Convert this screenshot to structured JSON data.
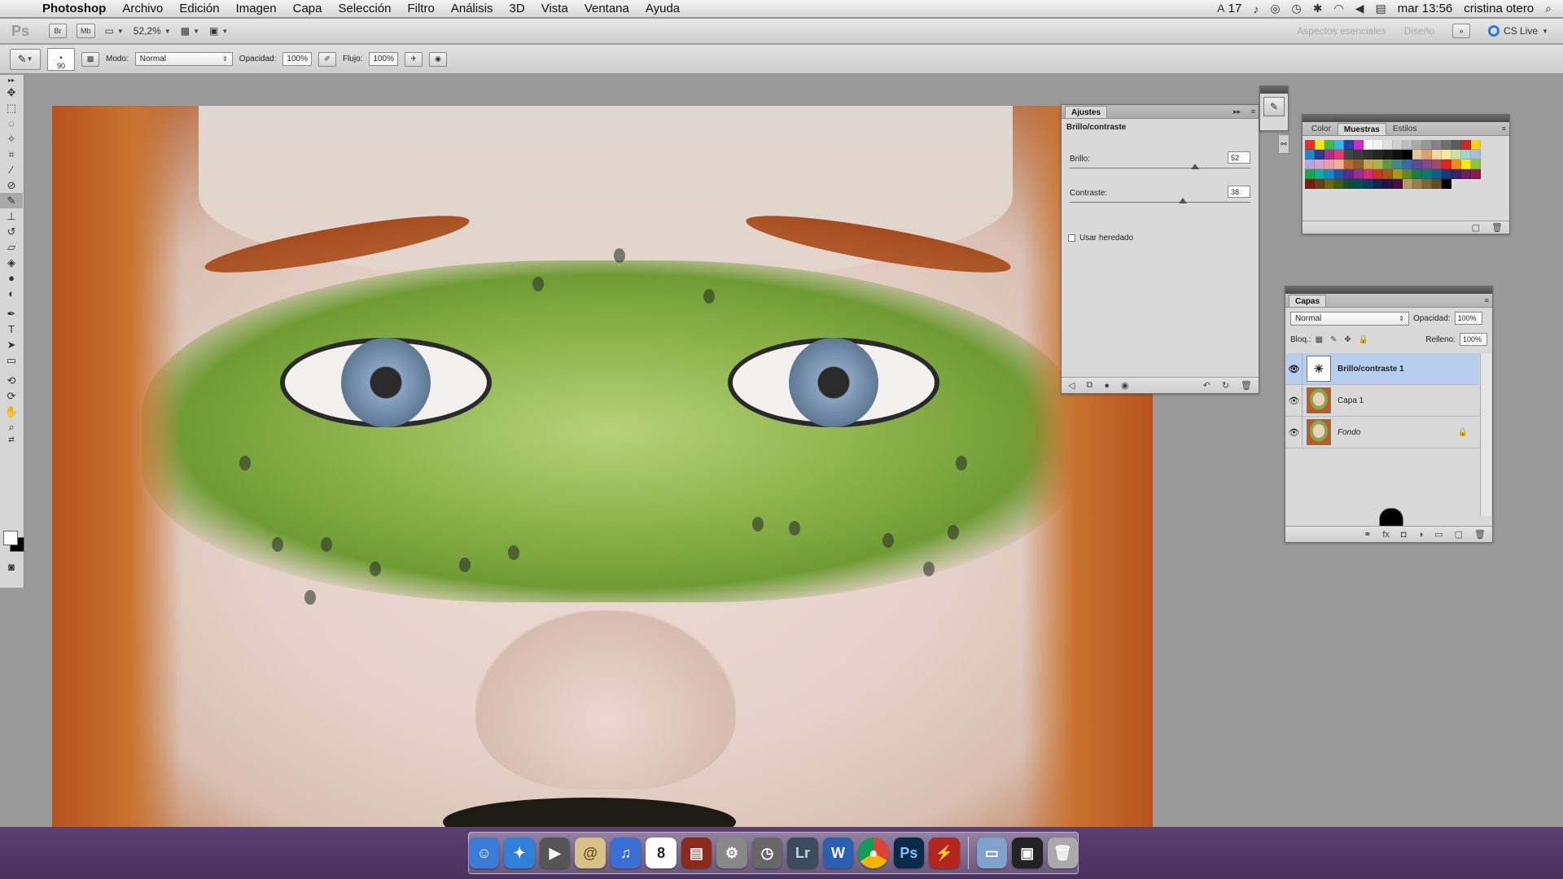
{
  "menubar": {
    "app_name": "Photoshop",
    "items": [
      "Archivo",
      "Edición",
      "Imagen",
      "Capa",
      "Selección",
      "Filtro",
      "Análisis",
      "3D",
      "Vista",
      "Ventana",
      "Ayuda"
    ],
    "status_count": "17",
    "clock": "mar 13:56",
    "user": "cristina otero"
  },
  "appbar": {
    "logo": "Ps",
    "br_label": "Br",
    "mb_label": "Mb",
    "zoom": "52,2%",
    "workspace_essentials": "Aspectos esenciales",
    "workspace_design": "Diseño",
    "cs_live": "CS Live"
  },
  "options": {
    "brush_size": "90",
    "mode_label": "Modo:",
    "mode_value": "Normal",
    "opacity_label": "Opacidad:",
    "opacity_value": "100%",
    "flow_label": "Flujo:",
    "flow_value": "100%"
  },
  "ajustes": {
    "tab": "Ajustes",
    "subtitle": "Brillo/contraste",
    "brightness_label": "Brillo:",
    "brightness_value": "52",
    "brightness_fraction": 0.76,
    "contrast_label": "Contraste:",
    "contrast_value": "38",
    "contrast_fraction": 0.69,
    "legacy_label": "Usar heredado"
  },
  "muestras": {
    "tabs": [
      "Color",
      "Muestras",
      "Estilos"
    ],
    "active_tab": "Muestras"
  },
  "capas": {
    "tab": "Capas",
    "blend_mode": "Normal",
    "opacity_label": "Opacidad:",
    "opacity_value": "100%",
    "lock_label": "Bloq.:",
    "fill_label": "Relleno:",
    "fill_value": "100%",
    "layers": [
      {
        "name": "Brillo/contraste 1",
        "selected": true
      },
      {
        "name": "Capa 1",
        "selected": false
      },
      {
        "name": "Fondo",
        "selected": false
      }
    ]
  },
  "dock": {
    "calendar_day": "8",
    "lightroom_label": "Lr",
    "word_label": "W",
    "photoshop_label": "Ps"
  },
  "colors": {
    "accent_selection": "#b7ceef",
    "dock_background": "#4a315e"
  }
}
